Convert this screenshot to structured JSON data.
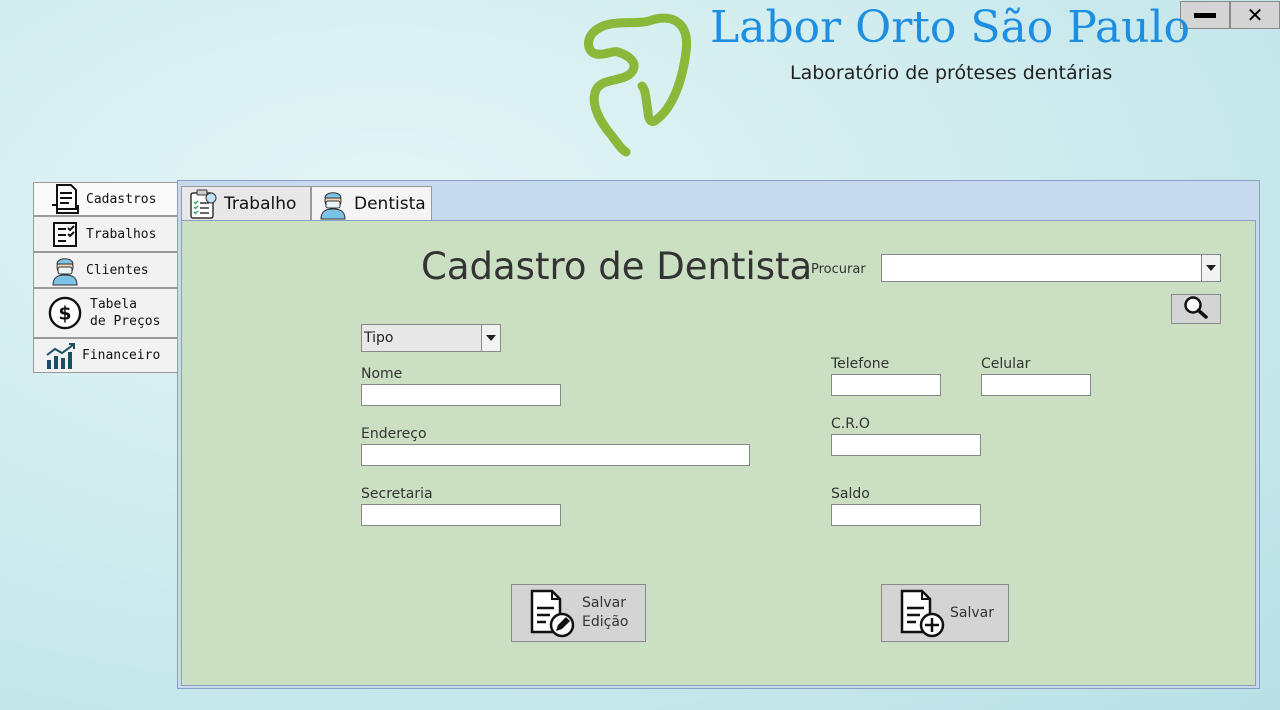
{
  "header": {
    "title": "Labor Orto São Paulo",
    "subtitle": "Laboratório de próteses dentárias"
  },
  "window": {
    "minimize_label": "",
    "close_label": "✕"
  },
  "sidebar": {
    "items": [
      {
        "label": "Cadastros",
        "icon": "document-list-icon"
      },
      {
        "label": "Trabalhos",
        "icon": "checklist-icon"
      },
      {
        "label": "Clientes",
        "icon": "dentist-icon"
      },
      {
        "label": "Tabela",
        "label2": "de Preços",
        "icon": "dollar-icon"
      },
      {
        "label": "Financeiro",
        "icon": "chart-icon"
      }
    ]
  },
  "tabs": [
    {
      "label": "Trabalho",
      "icon": "clipboard-tooth-icon"
    },
    {
      "label": "Dentista",
      "icon": "dentist-icon"
    }
  ],
  "form": {
    "title": "Cadastro de Dentista",
    "search_label": "Procurar",
    "search_value": "",
    "tipo_value": "Tipo",
    "fields": {
      "nome": {
        "label": "Nome",
        "value": ""
      },
      "endereco": {
        "label": "Endereço",
        "value": ""
      },
      "secretaria": {
        "label": "Secretaria",
        "value": ""
      },
      "telefone": {
        "label": "Telefone",
        "value": ""
      },
      "celular": {
        "label": "Celular",
        "value": ""
      },
      "cro": {
        "label": "C.R.O",
        "value": ""
      },
      "saldo": {
        "label": "Saldo",
        "value": ""
      }
    },
    "buttons": {
      "salvar_edicao_1": "Salvar",
      "salvar_edicao_2": "Edição",
      "salvar": "Salvar"
    }
  },
  "colors": {
    "title_blue": "#1e8fe0",
    "logo_green": "#8ab83a",
    "panel_green": "#cbdfc2",
    "panel_blue": "#c6d9ee"
  }
}
